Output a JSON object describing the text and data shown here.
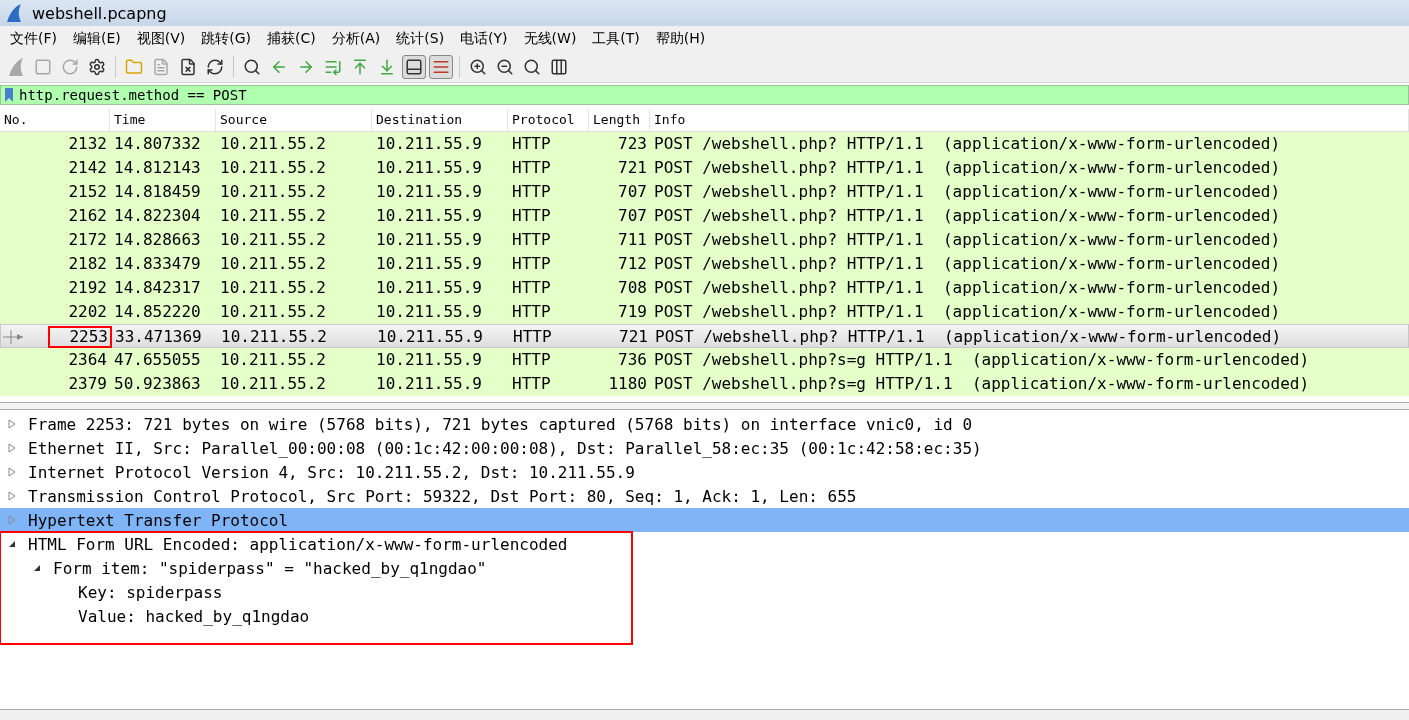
{
  "window": {
    "title": "webshell.pcapng"
  },
  "menu": [
    "文件(F)",
    "编辑(E)",
    "视图(V)",
    "跳转(G)",
    "捕获(C)",
    "分析(A)",
    "统计(S)",
    "电话(Y)",
    "无线(W)",
    "工具(T)",
    "帮助(H)"
  ],
  "toolbar": [
    {
      "kind": "shark-fin",
      "disabled": true
    },
    {
      "kind": "stop",
      "disabled": true
    },
    {
      "kind": "restart",
      "disabled": true
    },
    {
      "kind": "gear",
      "disabled": false
    },
    {
      "kind": "sep"
    },
    {
      "kind": "folder",
      "disabled": false
    },
    {
      "kind": "file",
      "disabled": true
    },
    {
      "kind": "close-file",
      "disabled": false
    },
    {
      "kind": "reload",
      "disabled": false
    },
    {
      "kind": "sep"
    },
    {
      "kind": "search",
      "disabled": false
    },
    {
      "kind": "back",
      "disabled": false
    },
    {
      "kind": "forward",
      "disabled": false
    },
    {
      "kind": "goto",
      "disabled": false
    },
    {
      "kind": "first",
      "disabled": false
    },
    {
      "kind": "last",
      "disabled": false
    },
    {
      "kind": "autoscroll",
      "disabled": false,
      "on": true
    },
    {
      "kind": "colorize",
      "disabled": false,
      "on": true
    },
    {
      "kind": "sep"
    },
    {
      "kind": "zoom-in",
      "disabled": false
    },
    {
      "kind": "zoom-out",
      "disabled": false
    },
    {
      "kind": "zoom-reset",
      "disabled": false
    },
    {
      "kind": "resize-columns",
      "disabled": false
    }
  ],
  "filter": {
    "value": "http.request.method == POST"
  },
  "packet_list": {
    "columns": [
      "No.",
      "Time",
      "Source",
      "Destination",
      "Protocol",
      "Length",
      "Info"
    ],
    "rows": [
      {
        "no": "2132",
        "time": "14.807332",
        "source": "10.211.55.2",
        "destination": "10.211.55.9",
        "protocol": "HTTP",
        "length": "723",
        "info": "POST /webshell.php? HTTP/1.1  (application/x-www-form-urlencoded)",
        "selected": false,
        "highlighted": false
      },
      {
        "no": "2142",
        "time": "14.812143",
        "source": "10.211.55.2",
        "destination": "10.211.55.9",
        "protocol": "HTTP",
        "length": "721",
        "info": "POST /webshell.php? HTTP/1.1  (application/x-www-form-urlencoded)",
        "selected": false,
        "highlighted": false
      },
      {
        "no": "2152",
        "time": "14.818459",
        "source": "10.211.55.2",
        "destination": "10.211.55.9",
        "protocol": "HTTP",
        "length": "707",
        "info": "POST /webshell.php? HTTP/1.1  (application/x-www-form-urlencoded)",
        "selected": false,
        "highlighted": false
      },
      {
        "no": "2162",
        "time": "14.822304",
        "source": "10.211.55.2",
        "destination": "10.211.55.9",
        "protocol": "HTTP",
        "length": "707",
        "info": "POST /webshell.php? HTTP/1.1  (application/x-www-form-urlencoded)",
        "selected": false,
        "highlighted": false
      },
      {
        "no": "2172",
        "time": "14.828663",
        "source": "10.211.55.2",
        "destination": "10.211.55.9",
        "protocol": "HTTP",
        "length": "711",
        "info": "POST /webshell.php? HTTP/1.1  (application/x-www-form-urlencoded)",
        "selected": false,
        "highlighted": false
      },
      {
        "no": "2182",
        "time": "14.833479",
        "source": "10.211.55.2",
        "destination": "10.211.55.9",
        "protocol": "HTTP",
        "length": "712",
        "info": "POST /webshell.php? HTTP/1.1  (application/x-www-form-urlencoded)",
        "selected": false,
        "highlighted": false
      },
      {
        "no": "2192",
        "time": "14.842317",
        "source": "10.211.55.2",
        "destination": "10.211.55.9",
        "protocol": "HTTP",
        "length": "708",
        "info": "POST /webshell.php? HTTP/1.1  (application/x-www-form-urlencoded)",
        "selected": false,
        "highlighted": false
      },
      {
        "no": "2202",
        "time": "14.852220",
        "source": "10.211.55.2",
        "destination": "10.211.55.9",
        "protocol": "HTTP",
        "length": "719",
        "info": "POST /webshell.php? HTTP/1.1  (application/x-www-form-urlencoded)",
        "selected": false,
        "highlighted": false
      },
      {
        "no": "2253",
        "time": "33.471369",
        "source": "10.211.55.2",
        "destination": "10.211.55.9",
        "protocol": "HTTP",
        "length": "721",
        "info": "POST /webshell.php? HTTP/1.1  (application/x-www-form-urlencoded)",
        "selected": true,
        "highlighted": true
      },
      {
        "no": "2364",
        "time": "47.655055",
        "source": "10.211.55.2",
        "destination": "10.211.55.9",
        "protocol": "HTTP",
        "length": "736",
        "info": "POST /webshell.php?s=g HTTP/1.1  (application/x-www-form-urlencoded)",
        "selected": false,
        "highlighted": false
      },
      {
        "no": "2379",
        "time": "50.923863",
        "source": "10.211.55.2",
        "destination": "10.211.55.9",
        "protocol": "HTTP",
        "length": "1180",
        "info": "POST /webshell.php?s=g HTTP/1.1  (application/x-www-form-urlencoded)",
        "selected": false,
        "highlighted": false
      }
    ]
  },
  "details": [
    {
      "label": "Frame 2253: 721 bytes on wire (5768 bits), 721 bytes captured (5768 bits) on interface vnic0, id 0",
      "expanded": false,
      "selected": false,
      "highlighted": false
    },
    {
      "label": "Ethernet II, Src: Parallel_00:00:08 (00:1c:42:00:00:08), Dst: Parallel_58:ec:35 (00:1c:42:58:ec:35)",
      "expanded": false,
      "selected": false,
      "highlighted": false
    },
    {
      "label": "Internet Protocol Version 4, Src: 10.211.55.2, Dst: 10.211.55.9",
      "expanded": false,
      "selected": false,
      "highlighted": false
    },
    {
      "label": "Transmission Control Protocol, Src Port: 59322, Dst Port: 80, Seq: 1, Ack: 1, Len: 655",
      "expanded": false,
      "selected": false,
      "highlighted": false
    },
    {
      "label": "Hypertext Transfer Protocol",
      "expanded": false,
      "selected": true,
      "highlighted": false
    },
    {
      "label": "HTML Form URL Encoded: application/x-www-form-urlencoded",
      "expanded": true,
      "selected": false,
      "highlighted": true,
      "children": [
        {
          "label": "Form item: \"spiderpass\" = \"hacked_by_q1ngdao\"",
          "expanded": true,
          "selected": false,
          "highlighted": false,
          "children": [
            {
              "label": "Key: spiderpass"
            },
            {
              "label": "Value: hacked_by_q1ngdao"
            }
          ]
        }
      ]
    }
  ]
}
